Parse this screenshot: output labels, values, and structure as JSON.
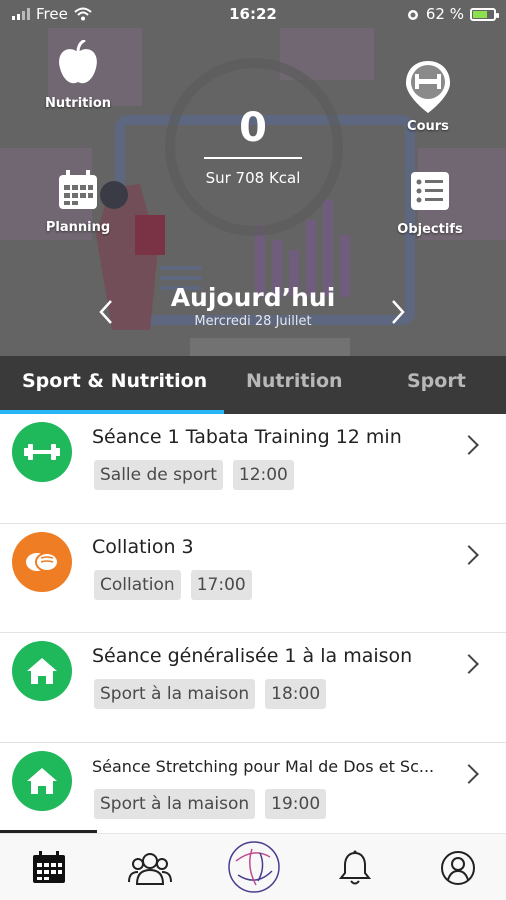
{
  "status_bar": {
    "carrier": "Free",
    "time": "16:22",
    "battery": "62 %"
  },
  "hero": {
    "nutrition_label": "Nutrition",
    "cours_label": "Cours",
    "planning_label": "Planning",
    "objectifs_label": "Objectifs",
    "kcal_value": "0",
    "kcal_sub": "Sur 708 Kcal",
    "day_title": "Aujourd’hui",
    "day_date": "Mercredi 28 Juillet",
    "prev_icon": "chevron-left-icon",
    "next_icon": "chevron-right-icon"
  },
  "tabs": [
    {
      "label": "Sport & Nutrition",
      "active": true
    },
    {
      "label": "Nutrition",
      "active": false
    },
    {
      "label": "Sport",
      "active": false
    }
  ],
  "colors": {
    "green": "#1fb85b",
    "orange": "#ef7d24",
    "tab_bar": "#3a3a3a",
    "tab_indicator": "#29b6f6"
  },
  "items": [
    {
      "title": "Séance 1 Tabata Training 12 min",
      "tag": "Salle de sport",
      "time": "12:00",
      "icon": "dumbbell-icon",
      "color": "green"
    },
    {
      "title": "Collation  3",
      "tag": "Collation",
      "time": "17:00",
      "icon": "snack-icon",
      "color": "orange"
    },
    {
      "title": "Séance généralisée 1 à la maison",
      "tag": "Sport à la maison",
      "time": "18:00",
      "icon": "home-icon",
      "color": "green"
    },
    {
      "title": "Séance Stretching pour Mal de Dos et Sc...",
      "tag": "Sport à la maison",
      "time": "19:00",
      "icon": "home-icon",
      "color": "green"
    }
  ],
  "bottom_nav": [
    {
      "icon": "calendar-icon"
    },
    {
      "icon": "community-icon"
    },
    {
      "icon": "app-logo-icon"
    },
    {
      "icon": "bell-icon"
    },
    {
      "icon": "profile-icon"
    }
  ]
}
